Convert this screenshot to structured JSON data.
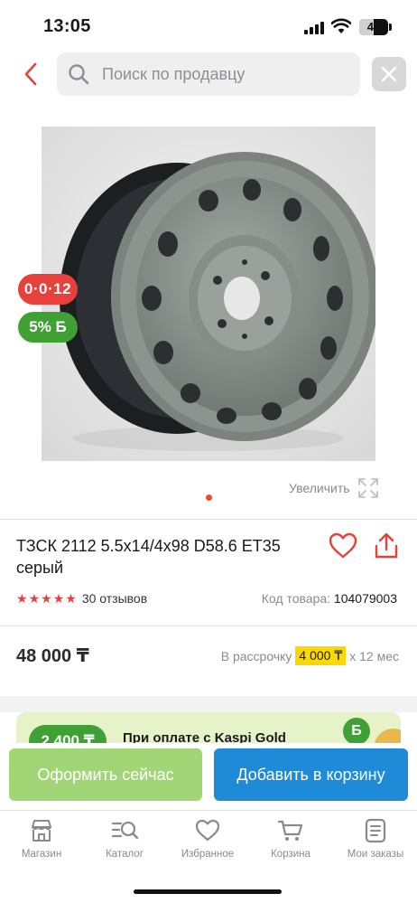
{
  "status_bar": {
    "time": "13:05",
    "battery": "49",
    "battery_level_percent": 49
  },
  "header": {
    "search_placeholder": "Поиск по продавцу",
    "back_icon": "chevron-left-icon",
    "close_icon": "close-icon"
  },
  "gallery": {
    "badge_bonus": "0·0·12",
    "badge_cashback": "5% Б",
    "zoom_label": "Увеличить",
    "current_slide": 1,
    "total_slides": 1
  },
  "product": {
    "title": "ТЗСК 2112 5.5х14/4х98 D58.6 ET35 серый",
    "rating_stars": 5,
    "reviews": "30 отзывов",
    "code_label": "Код товара:",
    "code_value": "104079003",
    "price": "48 000 ₸",
    "installment_label": "В рассрочку",
    "installment_amount": "4 000 ₸",
    "installment_term": "x 12 мес"
  },
  "promo": {
    "amount": "2 400 ₸",
    "text": "При оплате с Kaspi Gold",
    "icon": "Б"
  },
  "actions": {
    "buy_now": "Оформить сейчас",
    "add_to_cart": "Добавить в корзину"
  },
  "nav": [
    {
      "label": "Магазин",
      "icon": "shop-icon"
    },
    {
      "label": "Каталог",
      "icon": "catalog-search-icon"
    },
    {
      "label": "Избранное",
      "icon": "heart-icon"
    },
    {
      "label": "Корзина",
      "icon": "cart-icon"
    },
    {
      "label": "Мои заказы",
      "icon": "orders-icon"
    }
  ],
  "colors": {
    "accent_red": "#e8403a",
    "cashback_green": "#3fa034",
    "buy_button": "#a1d576",
    "cart_button": "#1f8bd8",
    "installment_highlight": "#fbd900"
  }
}
